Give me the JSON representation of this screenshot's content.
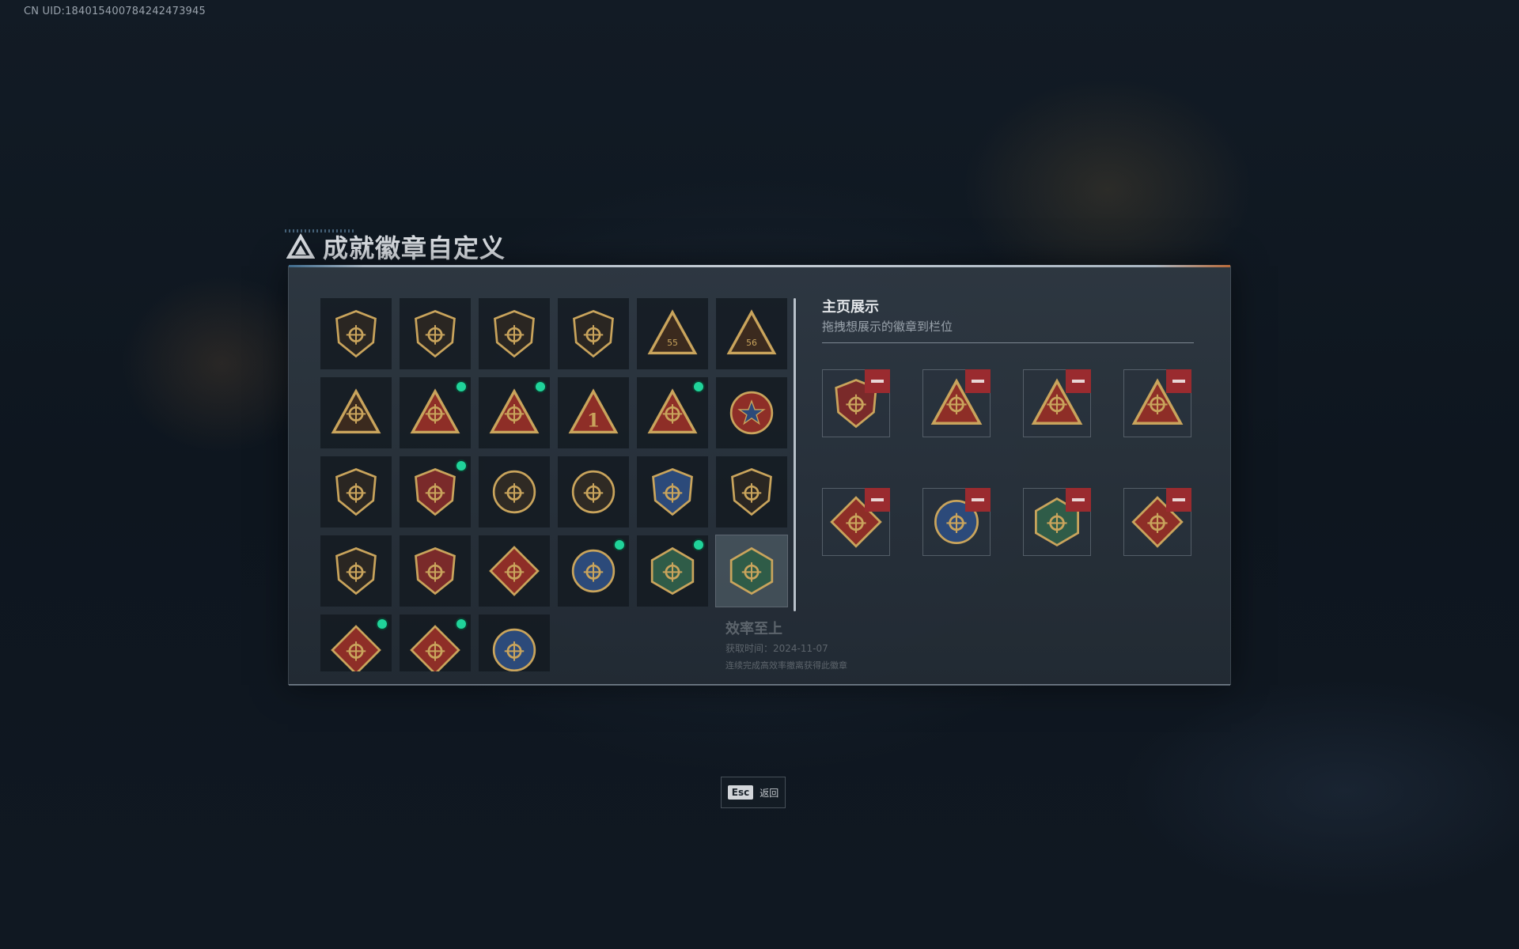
{
  "uid": "CN UID:184015400784242473945",
  "title": "成就徽章自定义",
  "showcase": {
    "title": "主页展示",
    "subtitle": "拖拽想展示的徽章到栏位",
    "slots": [
      {
        "icon": "crest-badge-icon"
      },
      {
        "icon": "red-triangle-badge-icon"
      },
      {
        "icon": "boat-triangle-badge-icon"
      },
      {
        "icon": "flower-triangle-badge-icon"
      },
      {
        "icon": "dragon-diamond-badge-icon"
      },
      {
        "icon": "eagle-round-badge-icon"
      },
      {
        "icon": "hornet-hex-badge-icon"
      },
      {
        "icon": "runner-diamond-badge-icon"
      }
    ]
  },
  "badges": [
    {
      "icon": "shield-badge-icon",
      "new": false
    },
    {
      "icon": "helicopter-shield-badge-icon",
      "new": false
    },
    {
      "icon": "diamond-shield-badge-icon",
      "new": false
    },
    {
      "icon": "arrow-shield-badge-icon",
      "new": false
    },
    {
      "icon": "triangle-55-badge-icon",
      "new": false
    },
    {
      "icon": "triangle-56-badge-icon",
      "new": false
    },
    {
      "icon": "triangle-frame-badge-icon",
      "new": false
    },
    {
      "icon": "flower-triangle-badge-icon",
      "new": true
    },
    {
      "icon": "boat-triangle-badge-icon",
      "new": true
    },
    {
      "icon": "number-one-triangle-badge-icon",
      "new": false
    },
    {
      "icon": "red-triangle-badge-icon",
      "new": true
    },
    {
      "icon": "star-medal-badge-icon",
      "new": false
    },
    {
      "icon": "small-shield-badge-icon",
      "new": false
    },
    {
      "icon": "crest-badge-icon",
      "new": true
    },
    {
      "icon": "skull-round-badge-icon",
      "new": false
    },
    {
      "icon": "gear-round-badge-icon",
      "new": false
    },
    {
      "icon": "blue-emblem-badge-icon",
      "new": false
    },
    {
      "icon": "rifle-shield-badge-icon",
      "new": false
    },
    {
      "icon": "target-shield-badge-icon",
      "new": false
    },
    {
      "icon": "wings-crest-badge-icon",
      "new": false
    },
    {
      "icon": "wolf-diamond-badge-icon",
      "new": false
    },
    {
      "icon": "eagle-round-badge-icon",
      "new": true
    },
    {
      "icon": "hornet-hex-badge-icon",
      "new": true
    },
    {
      "icon": "bullet-hex-badge-icon",
      "new": false
    },
    {
      "icon": "dragon-diamond-badge-icon",
      "new": true
    },
    {
      "icon": "runner-diamond-badge-icon",
      "new": true
    },
    {
      "icon": "wolf-round-badge-icon",
      "new": false
    }
  ],
  "tooltip": {
    "name": "效率至上",
    "date": "获取时间：2024-11-07",
    "desc": "连续完成高效率撤离获得此徽章"
  },
  "esc": {
    "key": "Esc",
    "label": "返回"
  },
  "colors": {
    "gold": "#c9a45c",
    "red": "#8e2e27",
    "blue": "#2c4a7a",
    "green": "#2f5c48",
    "dot": "#20d39a",
    "remove": "#9a2b2f"
  }
}
